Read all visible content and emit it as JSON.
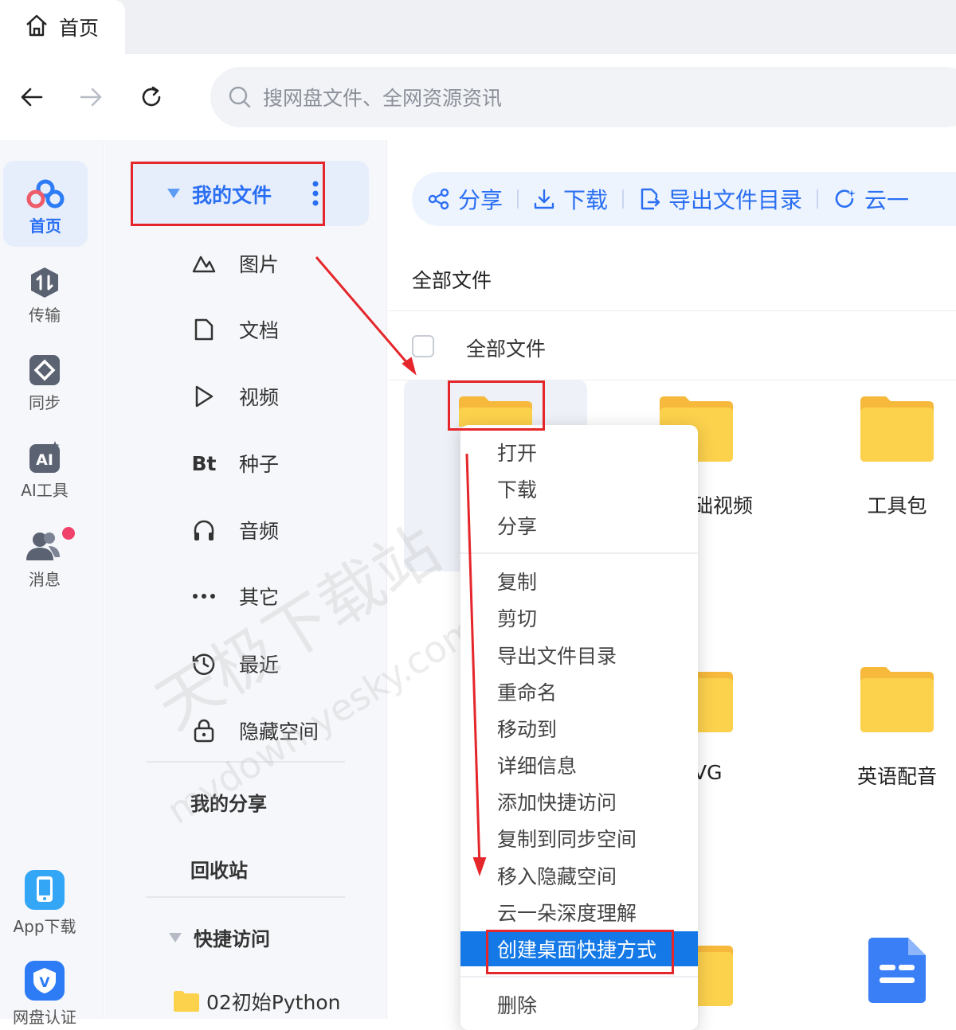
{
  "tabs": [
    {
      "label": "首页",
      "icon": "home-icon"
    }
  ],
  "nav": {
    "back_icon": "arrow-left-icon",
    "forward_icon": "arrow-right-icon",
    "refresh_icon": "refresh-icon",
    "search_placeholder": "搜网盘文件、全网资源资讯"
  },
  "rail": {
    "items": [
      {
        "label": "首页",
        "icon": "baidu-cloud-logo-icon",
        "active": true
      },
      {
        "label": "传输",
        "icon": "transfer-icon"
      },
      {
        "label": "同步",
        "icon": "sync-icon"
      },
      {
        "label": "AI工具",
        "icon": "ai-tool-icon"
      },
      {
        "label": "消息",
        "icon": "messages-icon",
        "badge": true
      }
    ],
    "bottom": [
      {
        "label": "App下载",
        "icon": "phone-icon"
      },
      {
        "label": "网盘认证",
        "icon": "verify-icon"
      }
    ]
  },
  "sidebar": {
    "my_files": "我的文件",
    "categories": [
      {
        "label": "图片",
        "icon": "image-icon"
      },
      {
        "label": "文档",
        "icon": "document-icon"
      },
      {
        "label": "视频",
        "icon": "video-play-icon"
      },
      {
        "label": "种子",
        "icon": "bt-icon",
        "icon_text": "Bt"
      },
      {
        "label": "音频",
        "icon": "headphones-icon"
      },
      {
        "label": "其它",
        "icon": "more-dots-icon"
      },
      {
        "label": "最近",
        "icon": "clock-icon"
      },
      {
        "label": "隐藏空间",
        "icon": "lock-icon"
      }
    ],
    "my_share": "我的分享",
    "recycle": "回收站",
    "quick_access": "快捷访问",
    "quick_items": [
      {
        "label": "02初始Python"
      }
    ]
  },
  "toolbar": [
    {
      "label": "分享",
      "icon": "share-icon"
    },
    {
      "label": "下载",
      "icon": "download-icon"
    },
    {
      "label": "导出文件目录",
      "icon": "export-icon"
    },
    {
      "label": "云一",
      "icon": "cloud-refresh-icon"
    }
  ],
  "main": {
    "breadcrumb": "全部文件",
    "header_label": "全部文件",
    "folders": [
      {
        "label": ""
      },
      {
        "label": "础视频"
      },
      {
        "label": "工具包"
      },
      {
        "label": ""
      },
      {
        "label": "VG"
      },
      {
        "label": "英语配音"
      }
    ]
  },
  "context_menu": {
    "group1": [
      "打开",
      "下载",
      "分享"
    ],
    "group2": [
      "复制",
      "剪切",
      "导出文件目录",
      "重命名",
      "移动到",
      "详细信息",
      "添加快捷访问",
      "复制到同步空间",
      "移入隐藏空间",
      "云一朵深度理解",
      "创建桌面快捷方式"
    ],
    "highlighted": "创建桌面快捷方式",
    "group3": [
      "删除"
    ]
  },
  "colors": {
    "accent": "#2a6ff3",
    "highlight": "#1479e6",
    "annotation": "#e5262b",
    "folder": "#fcd14c"
  },
  "watermark": {
    "line1": "天极下载站",
    "line2": "mydown.yesky.com"
  }
}
